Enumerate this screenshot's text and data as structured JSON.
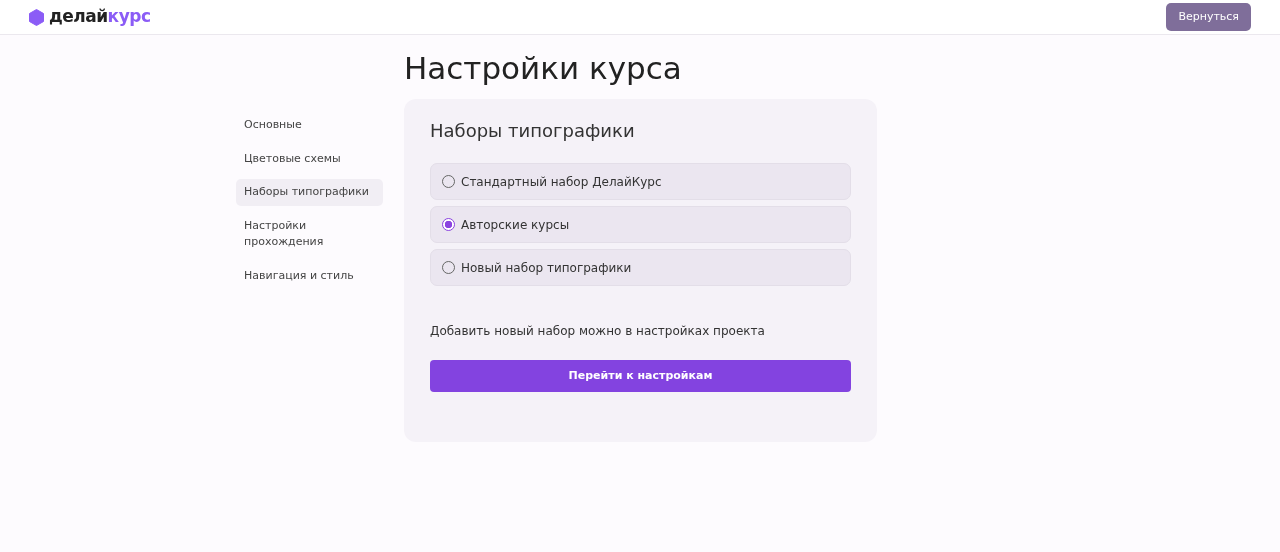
{
  "header": {
    "logo": {
      "word": "делай",
      "accent": "курс"
    },
    "back_button": "Вернуться"
  },
  "page_title": "Настройки курса",
  "sidebar": {
    "items": [
      {
        "label": "Основные",
        "selected": false
      },
      {
        "label": "Цветовые схемы",
        "selected": false
      },
      {
        "label": "Наборы типографики",
        "selected": true
      },
      {
        "label": "Настройки прохождения",
        "selected": false
      },
      {
        "label": "Навигация и стиль",
        "selected": false
      }
    ]
  },
  "panel": {
    "title": "Наборы типографики",
    "options": [
      {
        "label": "Стандартный набор ДелайКурс",
        "selected": false
      },
      {
        "label": "Авторские курсы",
        "selected": true
      },
      {
        "label": "Новый набор типографики",
        "selected": false
      }
    ],
    "hint": "Добавить новый набор можно в настройках проекта",
    "button": "Перейти к настройкам"
  }
}
